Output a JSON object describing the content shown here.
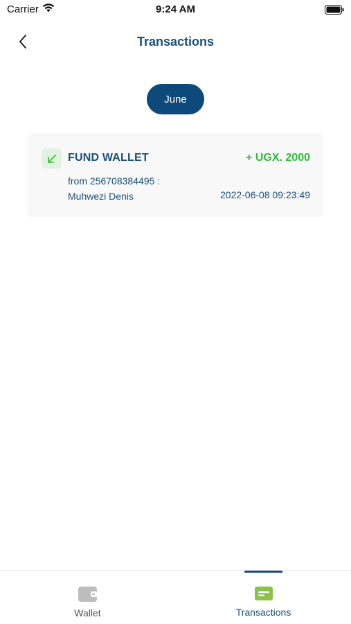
{
  "status_bar": {
    "carrier": "Carrier",
    "time": "9:24 AM",
    "icons": [
      "wifi-icon",
      "battery-icon"
    ]
  },
  "header": {
    "title": "Transactions",
    "back_icon": "chevron-left-icon"
  },
  "month_filter": {
    "label": "June"
  },
  "transactions": [
    {
      "type": "FUND WALLET",
      "amount": "+ UGX. 2000",
      "description": "from 256708384495 : Muhwezi Denis",
      "datetime": "2022-06-08 09:23:49",
      "icon": "arrow-down-left-icon",
      "amount_color": "#2fbf3a"
    }
  ],
  "tab_bar": {
    "tabs": [
      {
        "label": "Wallet",
        "icon": "wallet-icon",
        "active": false
      },
      {
        "label": "Transactions",
        "icon": "card-icon",
        "active": true
      }
    ]
  },
  "colors": {
    "primary": "#1b4f7a",
    "pill": "#0d4a7a",
    "credit": "#2fbf3a",
    "active_tab_icon": "#8bc34a",
    "inactive_tab_icon": "#bdbdbd"
  }
}
